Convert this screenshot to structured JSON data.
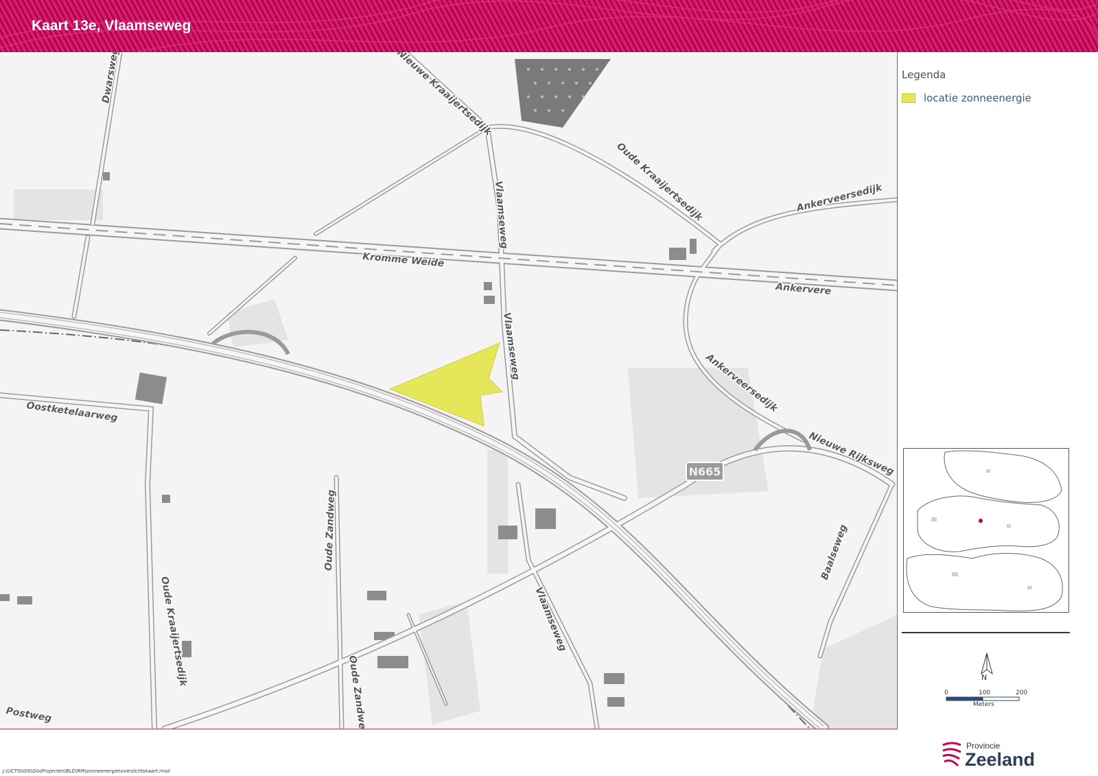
{
  "header": {
    "title": "Kaart 13e, Vlaamseweg"
  },
  "map": {
    "road_labels": [
      "Dwarsweg",
      "Nieuwe Kraaijertsedijk",
      "Oude Kraaijertsedijk",
      "Vlaamseweg",
      "Ankerveersedijk",
      "Kromme Weide",
      "Ankervere",
      "Vlaamseweg",
      "Ankerveersedijk",
      "Oostketelaarweg",
      "Nieuwe Rijksweg",
      "Oude Zandweg",
      "Oude Kraaijertsedijk",
      "Vlaamseweg",
      "Baalseweg",
      "Oude Zandweg",
      "Postweg"
    ],
    "road_shield": "N665",
    "highlight_color": "#e6e65a"
  },
  "legend": {
    "title": "Legenda",
    "items": [
      {
        "label": "locatie zonneenergie",
        "color": "#e6e65a"
      }
    ]
  },
  "scale": {
    "north": "N",
    "ticks": [
      "0",
      "100",
      "200"
    ],
    "unit": "Meters"
  },
  "footer": {
    "path": "J:\\UCTG\\GIS\\Gis\\Projecten\\BLD\\RM\\zonneenergie\\overzichtskaart.mxd"
  },
  "logo": {
    "line1": "Provincie",
    "line2": "Zeeland"
  }
}
